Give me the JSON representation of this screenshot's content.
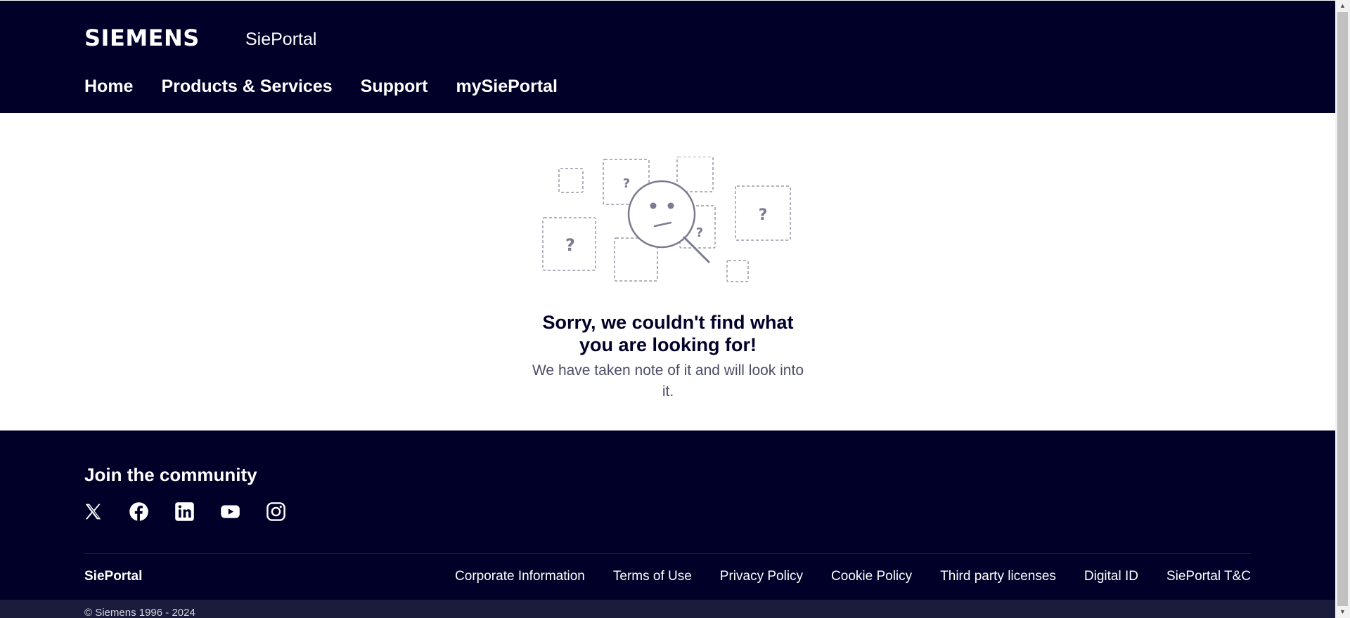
{
  "header": {
    "logo": "SIEMENS",
    "app_name": "SiePortal",
    "nav": [
      {
        "label": "Home"
      },
      {
        "label": "Products & Services"
      },
      {
        "label": "Support"
      },
      {
        "label": "mySiePortal"
      }
    ]
  },
  "error": {
    "title": "Sorry, we couldn't find what you are looking for!",
    "message": "We have taken note of it and will look into it.",
    "illustration": {
      "question_mark": "?",
      "icon": "magnifier-confused-face-icon"
    }
  },
  "footer": {
    "community_title": "Join the community",
    "social": [
      {
        "icon": "x-icon"
      },
      {
        "icon": "facebook-icon"
      },
      {
        "icon": "linkedin-icon"
      },
      {
        "icon": "youtube-icon"
      },
      {
        "icon": "instagram-icon"
      }
    ],
    "brand": "SiePortal",
    "links": [
      {
        "label": "Corporate Information"
      },
      {
        "label": "Terms of Use"
      },
      {
        "label": "Privacy Policy"
      },
      {
        "label": "Cookie Policy"
      },
      {
        "label": "Third party licenses"
      },
      {
        "label": "Digital ID"
      },
      {
        "label": "SiePortal T&C"
      }
    ],
    "copyright": "© Siemens 1996 - 2024"
  },
  "colors": {
    "brand_dark": "#000028",
    "text_secondary": "#4c4c68",
    "illustration_stroke": "#9999a9"
  }
}
